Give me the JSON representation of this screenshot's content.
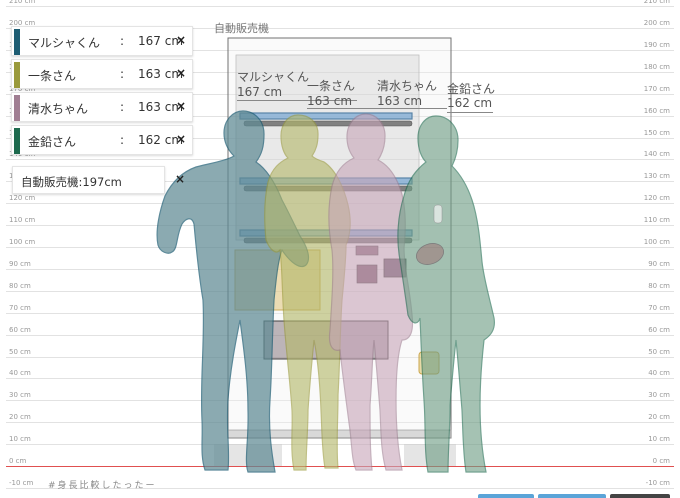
{
  "axis": {
    "ticks": [
      "-10 cm",
      "0 cm",
      "10 cm",
      "20 cm",
      "30 cm",
      "40 cm",
      "50 cm",
      "60 cm",
      "70 cm",
      "80 cm",
      "90 cm",
      "100 cm",
      "110 cm",
      "120 cm",
      "130 cm",
      "140 cm",
      "150 cm",
      "160 cm",
      "170 cm",
      "180 cm",
      "190 cm",
      "200 cm",
      "210 cm"
    ],
    "zero_line_color": "#e05050"
  },
  "characters": [
    {
      "name": "マルシャくん",
      "height": "167 cm",
      "height_cm": 167,
      "color": "#1e5d73",
      "fill": "#5f8a94"
    },
    {
      "name": "一条さん",
      "height": "163 cm",
      "height_cm": 163,
      "color": "#9a9a3c",
      "fill": "#b4b86a"
    },
    {
      "name": "清水ちゃん",
      "height": "163 cm",
      "height_cm": 163,
      "color": "#a07e92",
      "fill": "#c7a5b8"
    },
    {
      "name": "金鉛さん",
      "height": "162 cm",
      "height_cm": 162,
      "color": "#1e6a4e",
      "fill": "#6f9e86"
    }
  ],
  "legend": {
    "separator": ":",
    "close_glyph": "×"
  },
  "machine": {
    "legend_label": "自動販売機:197cm",
    "title": "自動販売機",
    "height_cm": 197
  },
  "overlay_labels": [
    {
      "name": "マルシャくん",
      "height": "167 cm"
    },
    {
      "name": "一条さん",
      "height": "163 cm"
    },
    {
      "name": "清水ちゃん",
      "height": "163 cm"
    },
    {
      "name": "金鉛さん",
      "height": "162 cm"
    }
  ],
  "footer": {
    "hashtag": "#身長比較したったー"
  }
}
